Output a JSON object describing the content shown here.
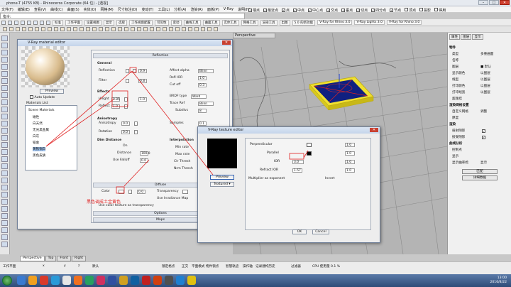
{
  "window": {
    "title": "phone-T (4755 KB) - Rhinoceros Corporate (64 位) - [透视]"
  },
  "menu": [
    "文件(F)",
    "编辑(E)",
    "查看(V)",
    "曲线(C)",
    "曲面(S)",
    "实体(O)",
    "网格(M)",
    "尺寸标注(D)",
    "变动(T)",
    "工具(L)",
    "分析(A)",
    "渲染(R)",
    "面板(P)",
    "V-Ray",
    "说明(H)"
  ],
  "osnap": [
    "端点",
    "最近点",
    "点",
    "中点",
    "中心点",
    "交点",
    "垂点",
    "切点",
    "四分点",
    "节点",
    "顶点",
    "投影",
    "停用"
  ],
  "command": {
    "prompt": "指令:"
  },
  "toolbar": {
    "tabs": [
      "标准",
      "工作平面",
      "设置视图",
      "显示",
      "选取",
      "工作视窗配置",
      "可见性",
      "变动",
      "曲线工具",
      "曲面工具",
      "实体工具",
      "网格工具",
      "渲染工具",
      "出图",
      "5.0 的新功能",
      "V-Ray for Rhino 3.0",
      "V-Ray Lights 3.0",
      "V-Ray for Rhino 3.0"
    ]
  },
  "viewport": {
    "title": "Perspective"
  },
  "viewport_tabs": [
    "Perspective",
    "Top",
    "Front",
    "Right"
  ],
  "material_editor": {
    "title": "V-Ray material editor",
    "preview_btn": "Preview",
    "auto_update": "Auto Update",
    "list_header": "Materials List",
    "list": [
      "Scene Materials",
      "磁性",
      "白天然",
      "无光黑金属",
      "白灰",
      "铂金",
      "黄铁铜白",
      "黑色皮质"
    ],
    "selected_index": 6,
    "sections": {
      "reflection": "Reflection",
      "general": "General",
      "fresnel": "Effects",
      "anisotropy": "Anisotropy",
      "glossy": "Dim Distance",
      "interp": "Interpolation",
      "options": "Options",
      "maps": "Maps",
      "diffuse": "Diffuse"
    },
    "labels": {
      "reflection": "Reflection",
      "filter": "Filter",
      "highlight": "Hilight",
      "reflect_gloss": "Reflect",
      "fresnel": "Fresnel",
      "refl_ior": "Refl IOR",
      "anisotropy": "Anisotropy",
      "rotation": "Rotation",
      "dim_distance": "Dim Distance",
      "on": "On",
      "distance": "Distance",
      "use_falloff": "Use Falloff",
      "interpolation": "Interpolation",
      "min_rate": "Min rate",
      "max_rate": "Max rate",
      "clr_thresh": "Clr Thresh",
      "nrm_thresh": "Nrm Thresh",
      "samples": "Samples",
      "brdf_type": "BRDF type",
      "subdivs": "Subdivs",
      "cutoff": "Cut off",
      "affect_alpha": "Affect alpha",
      "trace_reflections": "Trace Ref",
      "ward": "Ward",
      "gloss_type": "Blinn",
      "color": "Color",
      "transparency": "Transparency",
      "use_color_tex": "Use color texture as transparency",
      "use_irradiance": "Use Irradiance Map",
      "double_sided": "Double Sided"
    },
    "values": {
      "r1": "0.9",
      "r2": "0.8",
      "r3": "1.0",
      "r4": "1.0",
      "g1": "0.85",
      "g2": "1.0",
      "a1": "0.0",
      "a2": "0.0",
      "d1": "100.0",
      "d2": "0.0",
      "s1": "8",
      "s2": "0.0",
      "s3": "-3",
      "s4": "0",
      "s5": "0.3",
      "s6": "0.1",
      "b1": "0.0"
    },
    "annotation": "黑色调成土金黄色"
  },
  "texture_editor": {
    "title": "V-Ray texture editor",
    "preview_btn": "Preview",
    "type": "Textured",
    "labels": {
      "perp": "Perpendicular",
      "parallel": "Parallel",
      "ior": "IOR",
      "refract_ior": "Refract IOR",
      "multiplier": "Multiplier as exponent",
      "invert": "Invert"
    },
    "values": {
      "v1": "1.0",
      "v2": "1.0",
      "ior": "3.0",
      "v4": "1.0",
      "v5": "1.57",
      "v6": "1.0"
    },
    "ok": "OK",
    "cancel": "Cancel"
  },
  "right_panel": {
    "tabs": [
      "属性",
      "图层",
      "显示"
    ],
    "section": "物件",
    "rows": [
      {
        "label": "类型",
        "value": "多重曲面"
      },
      {
        "label": "名称",
        "value": ""
      },
      {
        "label": "图层",
        "value": "■ 默认"
      },
      {
        "label": "显示颜色",
        "value": "以图层"
      },
      {
        "label": "线型",
        "value": "以图层"
      },
      {
        "label": "打印颜色",
        "value": "以图层"
      },
      {
        "label": "打印线宽",
        "value": "以图层"
      },
      {
        "label": "超连结",
        "value": ""
      }
    ],
    "section2": "渲染网格设置",
    "rows2": [
      {
        "label": "自定义网格",
        "value": "调整"
      },
      {
        "label": "厚度",
        "value": ""
      }
    ],
    "section3": "渲染",
    "rows3": [
      {
        "label": "投射阴影",
        "value": "✓"
      },
      {
        "label": "接受阴影",
        "value": "✓"
      }
    ],
    "section4": "曲线分析",
    "rows4": [
      {
        "label": "控制点",
        "value": ""
      },
      {
        "label": "显示",
        "value": ""
      },
      {
        "label": "显示曲率梳",
        "value": "显示"
      }
    ],
    "btn_match": "匹配",
    "btn_details": "详细数据"
  },
  "status": {
    "cells": [
      "工作平面",
      "x",
      "y",
      "z",
      "默认",
      "锁定格点",
      "正交",
      "平面模式",
      "物件锁点",
      "智慧轨迹",
      "操作轴",
      "记录建构历史",
      "过滤器",
      "CPU 使用量 0.1 %"
    ]
  },
  "taskbar": {
    "time": "13:00",
    "date": "2016/8/22"
  },
  "colors": {
    "accent": "#e02020",
    "phone_body": "#f0e030",
    "phone_screen": "#102080"
  }
}
